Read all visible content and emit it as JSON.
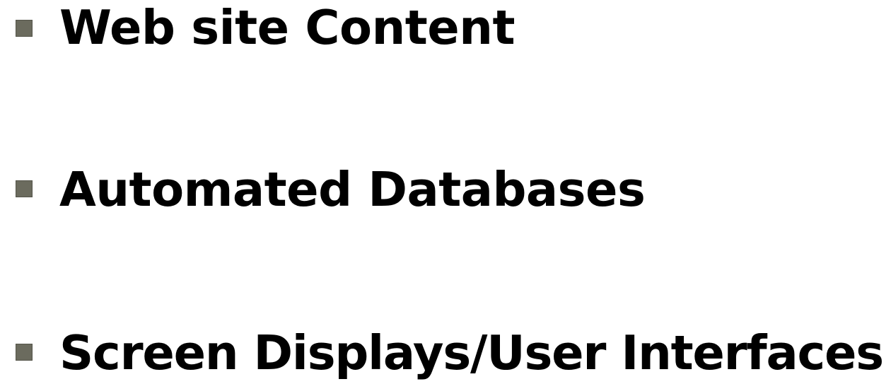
{
  "bullets": [
    {
      "label": "Web site Content",
      "marker_color": "#6b6b5e"
    },
    {
      "label": "Automated Databases",
      "marker_color": "#6b6b5e"
    },
    {
      "label": "Screen Displays/User Interfaces",
      "marker_color": "#6b6b5e"
    }
  ]
}
